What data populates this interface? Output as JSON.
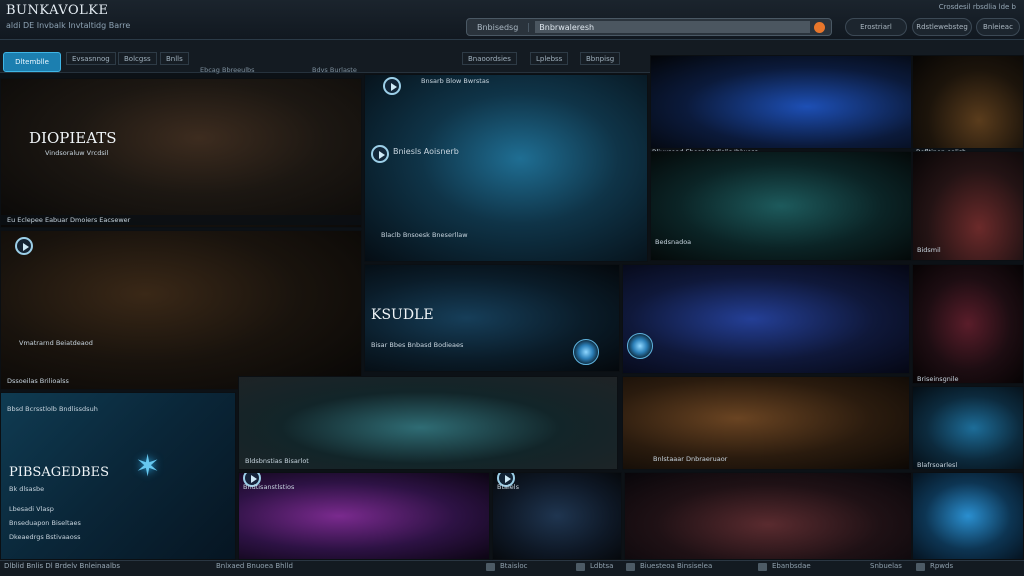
{
  "header": {
    "title": "BUNKAVOLKE",
    "subtitle": "aldi DE Invbalk Invtaltidg Barre",
    "search_label": "Bnbisedsg",
    "search_value": "Bnbrwaleresh",
    "top_right_text": "Crosdesil rbsdlia lde b",
    "pill_1": "Erostriarl",
    "pill_2": "Rdstlewebsteg",
    "pill_3": "Bnleieac"
  },
  "nav": {
    "active": "Dltemblle",
    "items": [
      "Evsasnnog",
      "Bolcgss",
      "Bnlls",
      "Bnaoordsies",
      "Lplebss",
      "Bbnpisg"
    ],
    "sublines": [
      "Ebcag Bbreeulbs",
      "Bdvs Burlaste"
    ]
  },
  "tiles": {
    "t1_big": "DIOPIEATS",
    "t1_sub": "Vindsoraluw Vrcdsil",
    "t1_bottom": "Eu Eclepee   Eabuar Dmoiers Eacsewer",
    "t2_sub": "Vmatrarnd Beiatdeaod",
    "t2_bottom": "Dssoeilas Brilioalss",
    "t3_header": "Bnsarb Blow Bwrstas",
    "t3_mid": "Bniesls Aoisnerb",
    "t3_bottom": "Blaclb Bnsoesk  Bneserllaw",
    "t4_bottom": "Bliuxsoad Ehoss Bodlolis Iblwoss",
    "t5_bottom": "Bofltinon ealisb",
    "t6_label": "Bedsnadoa",
    "t7_label": "Bidsmil",
    "t8_big": "KSUDLE",
    "t8_bottom": "Bisar Bbes Bnbasd Bodieaes",
    "t10_label": "Briseinsgnile",
    "t11_big": "PIBSAGEDBES",
    "t11_sub": "Bk dlsasbe",
    "t11_items": [
      "Lbesadi Vlasp",
      "Bnseduapon Biseltaes",
      "Dkeaedrgs Bstivaaoss"
    ],
    "t11_header": "Bbsd Bcrsstlolb Bndlissdsuh",
    "t12_label": "Bldsbnstias Bisarlot",
    "t13_label": "Bnlstaaar Dnbraeruaor",
    "t14_label": "Blafrsoarlesl",
    "t15_label": "Bndtisanstlstios",
    "t16_label": "Btaiels"
  },
  "footer": {
    "left": "Dlblid Bnlis   Dl Brdelv Bnleinaalbs",
    "item_1": "Bnlxaed Bnuoea Bhlld",
    "item_2": "Btaisloc",
    "item_3": "Ldbtsa",
    "item_4": "Biuesteoa Binsiselea",
    "item_5": "Ebanbsdae",
    "item_6": "Snbuelas",
    "item_7": "Rpwds"
  },
  "colors": {
    "accent": "#1c7fb0",
    "search_go": "#e8762b"
  }
}
